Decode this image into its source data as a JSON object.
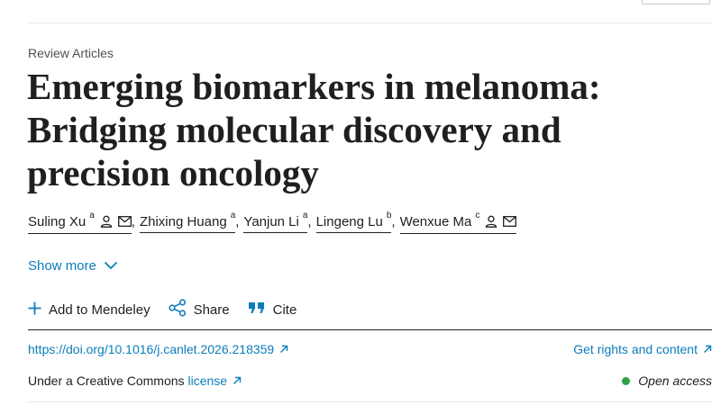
{
  "article": {
    "type": "Review Articles",
    "title": "Emerging biomarkers in melanoma: Bridging molecular discovery and precision oncology"
  },
  "authors": [
    {
      "name": "Suling Xu",
      "affil": "a",
      "person_icon": true,
      "mail_icon": true
    },
    {
      "name": "Zhixing Huang",
      "affil": "a",
      "person_icon": false,
      "mail_icon": false
    },
    {
      "name": "Yanjun Li",
      "affil": "a",
      "person_icon": false,
      "mail_icon": false
    },
    {
      "name": "Lingeng Lu",
      "affil": "b",
      "person_icon": false,
      "mail_icon": false
    },
    {
      "name": "Wenxue Ma",
      "affil": "c",
      "person_icon": true,
      "mail_icon": true
    }
  ],
  "show_more": {
    "label": "Show more",
    "icon": "chevron-down-icon"
  },
  "actions": {
    "mendeley": {
      "label": "Add to Mendeley",
      "icon": "plus-icon"
    },
    "share": {
      "label": "Share",
      "icon": "share-icon"
    },
    "cite": {
      "label": "Cite",
      "icon": "quote-icon"
    }
  },
  "links": {
    "doi": "https://doi.org/10.1016/j.canlet.2026.218359",
    "rights": "Get rights and content"
  },
  "license": {
    "prefix": "Under a Creative Commons",
    "link": "license"
  },
  "access": {
    "label": "Open access",
    "status_color": "#2fa046"
  },
  "colors": {
    "link": "#0c7dbb",
    "text": "#1f1f1f"
  }
}
